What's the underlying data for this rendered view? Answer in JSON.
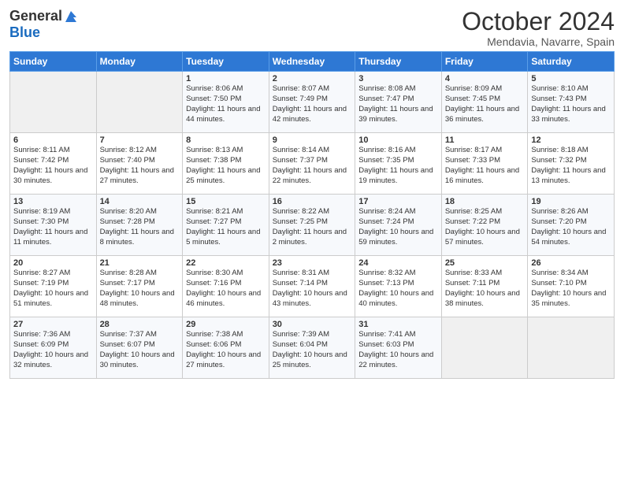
{
  "header": {
    "logo_general": "General",
    "logo_blue": "Blue",
    "month_title": "October 2024",
    "location": "Mendavia, Navarre, Spain"
  },
  "weekdays": [
    "Sunday",
    "Monday",
    "Tuesday",
    "Wednesday",
    "Thursday",
    "Friday",
    "Saturday"
  ],
  "weeks": [
    [
      {
        "day": null
      },
      {
        "day": null
      },
      {
        "day": 1,
        "sunrise": "Sunrise: 8:06 AM",
        "sunset": "Sunset: 7:50 PM",
        "daylight": "Daylight: 11 hours and 44 minutes."
      },
      {
        "day": 2,
        "sunrise": "Sunrise: 8:07 AM",
        "sunset": "Sunset: 7:49 PM",
        "daylight": "Daylight: 11 hours and 42 minutes."
      },
      {
        "day": 3,
        "sunrise": "Sunrise: 8:08 AM",
        "sunset": "Sunset: 7:47 PM",
        "daylight": "Daylight: 11 hours and 39 minutes."
      },
      {
        "day": 4,
        "sunrise": "Sunrise: 8:09 AM",
        "sunset": "Sunset: 7:45 PM",
        "daylight": "Daylight: 11 hours and 36 minutes."
      },
      {
        "day": 5,
        "sunrise": "Sunrise: 8:10 AM",
        "sunset": "Sunset: 7:43 PM",
        "daylight": "Daylight: 11 hours and 33 minutes."
      }
    ],
    [
      {
        "day": 6,
        "sunrise": "Sunrise: 8:11 AM",
        "sunset": "Sunset: 7:42 PM",
        "daylight": "Daylight: 11 hours and 30 minutes."
      },
      {
        "day": 7,
        "sunrise": "Sunrise: 8:12 AM",
        "sunset": "Sunset: 7:40 PM",
        "daylight": "Daylight: 11 hours and 27 minutes."
      },
      {
        "day": 8,
        "sunrise": "Sunrise: 8:13 AM",
        "sunset": "Sunset: 7:38 PM",
        "daylight": "Daylight: 11 hours and 25 minutes."
      },
      {
        "day": 9,
        "sunrise": "Sunrise: 8:14 AM",
        "sunset": "Sunset: 7:37 PM",
        "daylight": "Daylight: 11 hours and 22 minutes."
      },
      {
        "day": 10,
        "sunrise": "Sunrise: 8:16 AM",
        "sunset": "Sunset: 7:35 PM",
        "daylight": "Daylight: 11 hours and 19 minutes."
      },
      {
        "day": 11,
        "sunrise": "Sunrise: 8:17 AM",
        "sunset": "Sunset: 7:33 PM",
        "daylight": "Daylight: 11 hours and 16 minutes."
      },
      {
        "day": 12,
        "sunrise": "Sunrise: 8:18 AM",
        "sunset": "Sunset: 7:32 PM",
        "daylight": "Daylight: 11 hours and 13 minutes."
      }
    ],
    [
      {
        "day": 13,
        "sunrise": "Sunrise: 8:19 AM",
        "sunset": "Sunset: 7:30 PM",
        "daylight": "Daylight: 11 hours and 11 minutes."
      },
      {
        "day": 14,
        "sunrise": "Sunrise: 8:20 AM",
        "sunset": "Sunset: 7:28 PM",
        "daylight": "Daylight: 11 hours and 8 minutes."
      },
      {
        "day": 15,
        "sunrise": "Sunrise: 8:21 AM",
        "sunset": "Sunset: 7:27 PM",
        "daylight": "Daylight: 11 hours and 5 minutes."
      },
      {
        "day": 16,
        "sunrise": "Sunrise: 8:22 AM",
        "sunset": "Sunset: 7:25 PM",
        "daylight": "Daylight: 11 hours and 2 minutes."
      },
      {
        "day": 17,
        "sunrise": "Sunrise: 8:24 AM",
        "sunset": "Sunset: 7:24 PM",
        "daylight": "Daylight: 10 hours and 59 minutes."
      },
      {
        "day": 18,
        "sunrise": "Sunrise: 8:25 AM",
        "sunset": "Sunset: 7:22 PM",
        "daylight": "Daylight: 10 hours and 57 minutes."
      },
      {
        "day": 19,
        "sunrise": "Sunrise: 8:26 AM",
        "sunset": "Sunset: 7:20 PM",
        "daylight": "Daylight: 10 hours and 54 minutes."
      }
    ],
    [
      {
        "day": 20,
        "sunrise": "Sunrise: 8:27 AM",
        "sunset": "Sunset: 7:19 PM",
        "daylight": "Daylight: 10 hours and 51 minutes."
      },
      {
        "day": 21,
        "sunrise": "Sunrise: 8:28 AM",
        "sunset": "Sunset: 7:17 PM",
        "daylight": "Daylight: 10 hours and 48 minutes."
      },
      {
        "day": 22,
        "sunrise": "Sunrise: 8:30 AM",
        "sunset": "Sunset: 7:16 PM",
        "daylight": "Daylight: 10 hours and 46 minutes."
      },
      {
        "day": 23,
        "sunrise": "Sunrise: 8:31 AM",
        "sunset": "Sunset: 7:14 PM",
        "daylight": "Daylight: 10 hours and 43 minutes."
      },
      {
        "day": 24,
        "sunrise": "Sunrise: 8:32 AM",
        "sunset": "Sunset: 7:13 PM",
        "daylight": "Daylight: 10 hours and 40 minutes."
      },
      {
        "day": 25,
        "sunrise": "Sunrise: 8:33 AM",
        "sunset": "Sunset: 7:11 PM",
        "daylight": "Daylight: 10 hours and 38 minutes."
      },
      {
        "day": 26,
        "sunrise": "Sunrise: 8:34 AM",
        "sunset": "Sunset: 7:10 PM",
        "daylight": "Daylight: 10 hours and 35 minutes."
      }
    ],
    [
      {
        "day": 27,
        "sunrise": "Sunrise: 7:36 AM",
        "sunset": "Sunset: 6:09 PM",
        "daylight": "Daylight: 10 hours and 32 minutes."
      },
      {
        "day": 28,
        "sunrise": "Sunrise: 7:37 AM",
        "sunset": "Sunset: 6:07 PM",
        "daylight": "Daylight: 10 hours and 30 minutes."
      },
      {
        "day": 29,
        "sunrise": "Sunrise: 7:38 AM",
        "sunset": "Sunset: 6:06 PM",
        "daylight": "Daylight: 10 hours and 27 minutes."
      },
      {
        "day": 30,
        "sunrise": "Sunrise: 7:39 AM",
        "sunset": "Sunset: 6:04 PM",
        "daylight": "Daylight: 10 hours and 25 minutes."
      },
      {
        "day": 31,
        "sunrise": "Sunrise: 7:41 AM",
        "sunset": "Sunset: 6:03 PM",
        "daylight": "Daylight: 10 hours and 22 minutes."
      },
      {
        "day": null
      },
      {
        "day": null
      }
    ]
  ]
}
